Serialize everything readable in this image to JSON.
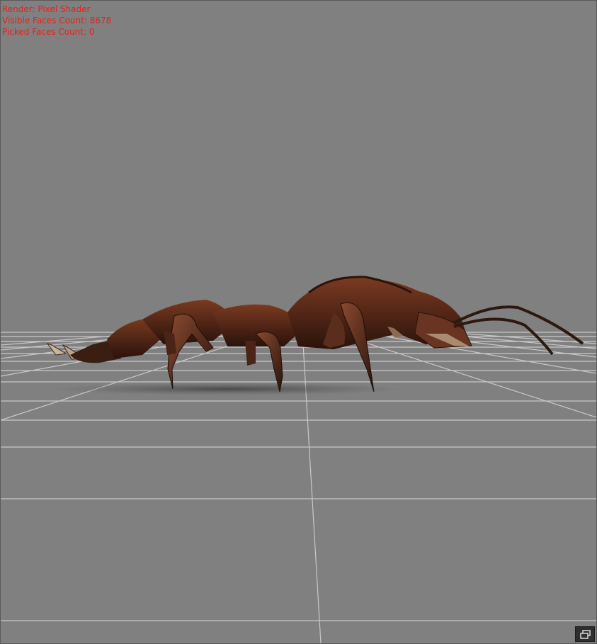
{
  "overlay": {
    "render": "Render: Pixel Shader",
    "visible_faces": "Visible Faces Count: 8678",
    "picked_faces": "Picked Faces Count: 0"
  },
  "icons": {
    "corner": "restore-window-icon"
  },
  "colors": {
    "background": "#808080",
    "grid": "#c8c8c8",
    "overlay_text": "#e8201a",
    "creature_body": "#5a2b1a"
  }
}
